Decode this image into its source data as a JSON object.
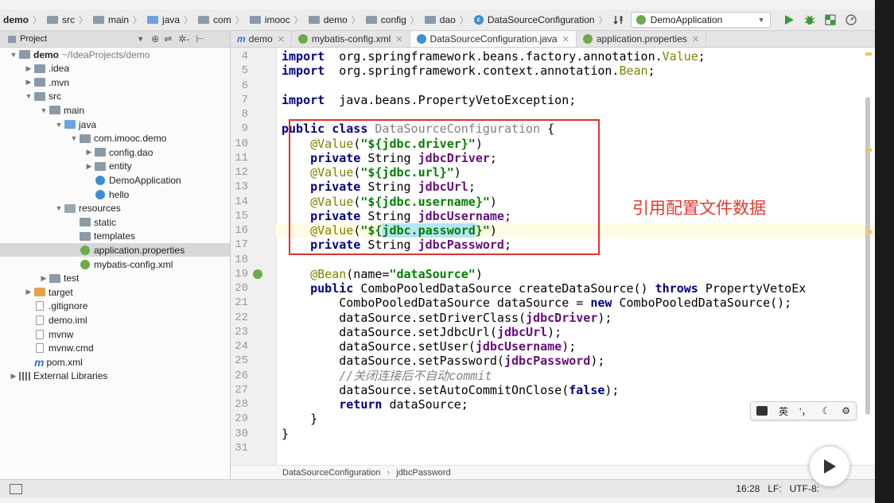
{
  "navbar": {
    "crumbs": [
      "demo",
      "src",
      "main",
      "java",
      "com",
      "imooc",
      "demo",
      "config",
      "dao",
      "DataSourceConfiguration"
    ],
    "run_config": "DemoApplication"
  },
  "project_panel": {
    "title": "Project"
  },
  "tabs": [
    {
      "label": "demo",
      "active": false
    },
    {
      "label": "mybatis-config.xml",
      "active": false
    },
    {
      "label": "DataSourceConfiguration.java",
      "active": true
    },
    {
      "label": "application.properties",
      "active": false
    }
  ],
  "tree": [
    {
      "label": "demo",
      "extra": "~/IdeaProjects/demo",
      "depth": 0,
      "icon": "folder",
      "arrow": "down"
    },
    {
      "label": ".idea",
      "depth": 1,
      "icon": "folder",
      "arrow": "right"
    },
    {
      "label": ".mvn",
      "depth": 1,
      "icon": "folder",
      "arrow": "right"
    },
    {
      "label": "src",
      "depth": 1,
      "icon": "folder",
      "arrow": "down"
    },
    {
      "label": "main",
      "depth": 2,
      "icon": "folder",
      "arrow": "down"
    },
    {
      "label": "java",
      "depth": 3,
      "icon": "folder-blue",
      "arrow": "down"
    },
    {
      "label": "com.imooc.demo",
      "depth": 4,
      "icon": "folder",
      "arrow": "down"
    },
    {
      "label": "config.dao",
      "depth": 5,
      "icon": "folder",
      "arrow": "right"
    },
    {
      "label": "entity",
      "depth": 5,
      "icon": "folder",
      "arrow": "right"
    },
    {
      "label": "DemoApplication",
      "depth": 5,
      "icon": "class",
      "arrow": ""
    },
    {
      "label": "hello",
      "depth": 5,
      "icon": "class",
      "arrow": ""
    },
    {
      "label": "resources",
      "depth": 3,
      "icon": "folder-res",
      "arrow": "down"
    },
    {
      "label": "static",
      "depth": 4,
      "icon": "folder",
      "arrow": ""
    },
    {
      "label": "templates",
      "depth": 4,
      "icon": "folder",
      "arrow": ""
    },
    {
      "label": "application.properties",
      "depth": 4,
      "icon": "spring",
      "arrow": "",
      "selected": true
    },
    {
      "label": "mybatis-config.xml",
      "depth": 4,
      "icon": "spring",
      "arrow": ""
    },
    {
      "label": "test",
      "depth": 2,
      "icon": "folder",
      "arrow": "right"
    },
    {
      "label": "target",
      "depth": 1,
      "icon": "folder-orange",
      "arrow": "right"
    },
    {
      "label": ".gitignore",
      "depth": 1,
      "icon": "file",
      "arrow": ""
    },
    {
      "label": "demo.iml",
      "depth": 1,
      "icon": "file",
      "arrow": ""
    },
    {
      "label": "mvnw",
      "depth": 1,
      "icon": "file",
      "arrow": ""
    },
    {
      "label": "mvnw.cmd",
      "depth": 1,
      "icon": "file",
      "arrow": ""
    },
    {
      "label": "pom.xml",
      "depth": 1,
      "icon": "mlogo",
      "arrow": ""
    },
    {
      "label": "External Libraries",
      "depth": 0,
      "icon": "lib",
      "arrow": "right"
    }
  ],
  "editor": {
    "first_line": 4,
    "current_line": 16,
    "lines": [
      [
        [
          "kw",
          "import"
        ],
        [
          "",
          "  org.springframework.beans.factory.annotation."
        ],
        [
          "ann",
          "Value"
        ],
        [
          "",
          ";"
        ]
      ],
      [
        [
          "kw",
          "import"
        ],
        [
          "",
          "  org.springframework.context.annotation."
        ],
        [
          "ann",
          "Bean"
        ],
        [
          "",
          ";"
        ]
      ],
      [],
      [
        [
          "kw",
          "import"
        ],
        [
          "",
          "  java.beans.PropertyVetoException;"
        ]
      ],
      [],
      [
        [
          "kw",
          "public class "
        ],
        [
          "grey",
          "DataSourceConfiguration"
        ],
        [
          "",
          " {"
        ]
      ],
      [
        [
          "",
          "    "
        ],
        [
          "ann",
          "@Value"
        ],
        [
          "",
          "("
        ],
        [
          "str",
          "\"${jdbc.driver}\""
        ],
        [
          "",
          ")"
        ]
      ],
      [
        [
          "",
          "    "
        ],
        [
          "kw",
          "private "
        ],
        [
          "",
          "String "
        ],
        [
          "fld",
          "jdbcDriver"
        ],
        [
          "",
          ";"
        ]
      ],
      [
        [
          "",
          "    "
        ],
        [
          "ann",
          "@Value"
        ],
        [
          "",
          "("
        ],
        [
          "str",
          "\"${jdbc.url}\""
        ],
        [
          "",
          ")"
        ]
      ],
      [
        [
          "",
          "    "
        ],
        [
          "kw",
          "private "
        ],
        [
          "",
          "String "
        ],
        [
          "fld",
          "jdbcUrl"
        ],
        [
          "",
          ";"
        ]
      ],
      [
        [
          "",
          "    "
        ],
        [
          "ann",
          "@Value"
        ],
        [
          "",
          "("
        ],
        [
          "str",
          "\"${jdbc.username}\""
        ],
        [
          "",
          ")"
        ]
      ],
      [
        [
          "",
          "    "
        ],
        [
          "kw",
          "private "
        ],
        [
          "",
          "String "
        ],
        [
          "fld",
          "jdbcUsername"
        ],
        [
          "",
          ";"
        ]
      ],
      [
        [
          "",
          "    "
        ],
        [
          "ann",
          "@Value"
        ],
        [
          "",
          "("
        ],
        [
          "str",
          "\"${"
        ],
        [
          "strhl",
          "jdbc.password"
        ],
        [
          "str",
          "}\""
        ],
        [
          "",
          ")"
        ]
      ],
      [
        [
          "",
          "    "
        ],
        [
          "kw",
          "private "
        ],
        [
          "",
          "String "
        ],
        [
          "fld",
          "jdbcPassword"
        ],
        [
          "",
          ";"
        ]
      ],
      [],
      [
        [
          "",
          "    "
        ],
        [
          "ann",
          "@Bean"
        ],
        [
          "",
          "(name="
        ],
        [
          "str",
          "\"dataSource\""
        ],
        [
          "",
          ")"
        ]
      ],
      [
        [
          "",
          "    "
        ],
        [
          "kw",
          "public "
        ],
        [
          "",
          "ComboPooledDataSource createDataSource() "
        ],
        [
          "kw",
          "throws "
        ],
        [
          "",
          "PropertyVetoEx"
        ]
      ],
      [
        [
          "",
          "        ComboPooledDataSource dataSource = "
        ],
        [
          "kw",
          "new "
        ],
        [
          "",
          "ComboPooledDataSource();"
        ]
      ],
      [
        [
          "",
          "        dataSource.setDriverClass("
        ],
        [
          "fld",
          "jdbcDriver"
        ],
        [
          "",
          ");"
        ]
      ],
      [
        [
          "",
          "        dataSource.setJdbcUrl("
        ],
        [
          "fld",
          "jdbcUrl"
        ],
        [
          "",
          ");"
        ]
      ],
      [
        [
          "",
          "        dataSource.setUser("
        ],
        [
          "fld",
          "jdbcUsername"
        ],
        [
          "",
          ");"
        ]
      ],
      [
        [
          "",
          "        dataSource.setPassword("
        ],
        [
          "fld",
          "jdbcPassword"
        ],
        [
          "",
          ");"
        ]
      ],
      [
        [
          "",
          "        "
        ],
        [
          "cmt",
          "//关闭连接后不自动commit"
        ]
      ],
      [
        [
          "",
          "        dataSource.setAutoCommitOnClose("
        ],
        [
          "kw",
          "false"
        ],
        [
          "",
          ");"
        ]
      ],
      [
        [
          "",
          "        "
        ],
        [
          "kw",
          "return "
        ],
        [
          "",
          "dataSource;"
        ]
      ],
      [
        [
          "",
          "    }"
        ]
      ],
      [
        [
          "",
          "}"
        ]
      ],
      []
    ]
  },
  "annotation_text": "引用配置文件数据",
  "editor_breadcrumb": [
    "DataSourceConfiguration",
    "jdbcPassword"
  ],
  "ime": {
    "lang": "英",
    "punct": "'，"
  },
  "status": {
    "position": "16:28",
    "line_sep": "LF:",
    "encoding": "UTF-8:"
  },
  "colors": {
    "highlight_box": "#e0322f",
    "annotation": "#e53a30",
    "keyword": "#000080",
    "string": "#008000",
    "field": "#660e7a"
  }
}
